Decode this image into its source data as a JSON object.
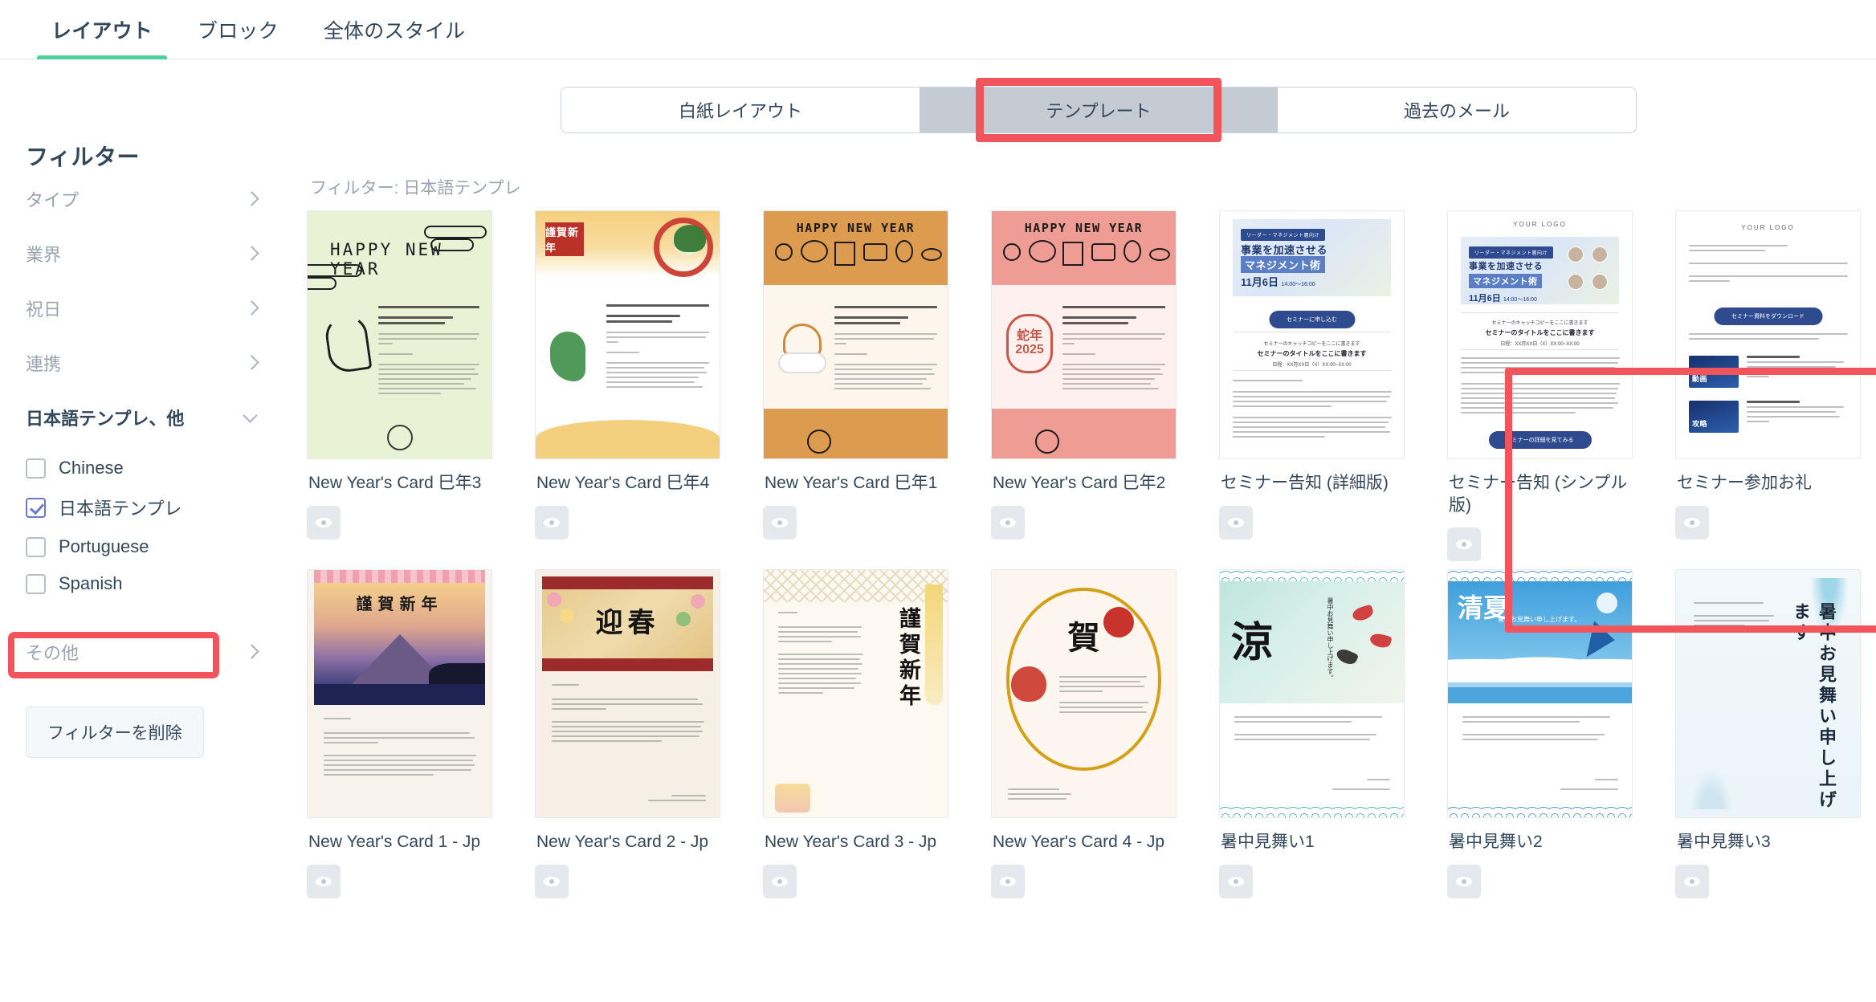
{
  "top_tabs": [
    {
      "label": "レイアウト",
      "active": true
    },
    {
      "label": "ブロック",
      "active": false
    },
    {
      "label": "全体のスタイル",
      "active": false
    }
  ],
  "segmented": {
    "options": [
      {
        "label": "白紙レイアウト",
        "selected": false
      },
      {
        "label": "テンプレート",
        "selected": true
      },
      {
        "label": "過去のメール",
        "selected": false
      }
    ]
  },
  "sidebar": {
    "title": "フィルター",
    "groups": [
      {
        "label": "タイプ",
        "expanded": false
      },
      {
        "label": "業界",
        "expanded": false
      },
      {
        "label": "祝日",
        "expanded": false
      },
      {
        "label": "連携",
        "expanded": false
      }
    ],
    "language_group": {
      "label": "日本語テンプレ、他",
      "expanded": true
    },
    "language_options": [
      {
        "label": "Chinese",
        "checked": false
      },
      {
        "label": "日本語テンプレ",
        "checked": true
      },
      {
        "label": "Portuguese",
        "checked": false
      },
      {
        "label": "Spanish",
        "checked": false
      }
    ],
    "other_group": {
      "label": "その他",
      "expanded": false
    },
    "clear_button": "フィルターを削除"
  },
  "main": {
    "filter_note": "フィルター: 日本語テンプレ",
    "preview_icon": "eye-icon"
  },
  "templates": [
    {
      "name": "New Year's Card 巳年3",
      "art": "ny3"
    },
    {
      "name": "New Year's Card 巳年4",
      "art": "ny4"
    },
    {
      "name": "New Year's Card 巳年1",
      "art": "ny1"
    },
    {
      "name": "New Year's Card 巳年2",
      "art": "ny2"
    },
    {
      "name": "セミナー告知 (詳細版)",
      "art": "sem1"
    },
    {
      "name": "セミナー告知 (シンプル版)",
      "art": "sem2"
    },
    {
      "name": "セミナー参加お礼",
      "art": "sem3"
    },
    {
      "name": "New Year's Card 1 - Jp",
      "art": "fuji"
    },
    {
      "name": "New Year's Card 2 - Jp",
      "art": "geishun"
    },
    {
      "name": "New Year's Card 3 - Jp",
      "art": "kinga"
    },
    {
      "name": "New Year's Card 4 - Jp",
      "art": "ga"
    },
    {
      "name": "暑中見舞い1",
      "art": "sum1"
    },
    {
      "name": "暑中見舞い2",
      "art": "sum2"
    },
    {
      "name": "暑中見舞い3",
      "art": "sum3"
    }
  ],
  "thumbnail_text": {
    "ny3": {
      "heading": "HAPPY NEW YEAR"
    },
    "ny4": {
      "stamp": "謹賀新年"
    },
    "ny1": {
      "heading": "HAPPY NEW YEAR"
    },
    "ny2": {
      "heading": "HAPPY NEW YEAR",
      "seal": "蛇年2025"
    },
    "sem1": {
      "tag": "リーダー・マネジメント層向け",
      "title1": "事業を加速させる",
      "title2": "マネジメント術",
      "date": "11月6日",
      "time": "14:00～16:00",
      "cta": "セミナーに申し込む",
      "catch": "セミナーのキャッチコピーをここに書きます",
      "subtitle": "セミナーのタイトルをここに書きます",
      "schedule": "日程：XX月XX日（X）XX:00~XX:00"
    },
    "sem2": {
      "logo": "YOUR LOGO",
      "tag": "リーダー・マネジメント層向け",
      "title1": "事業を加速させる",
      "title2": "マネジメント術",
      "date": "11月6日",
      "time": "14:00～16:00",
      "catch": "セミナーのキャッチコピーをここに書きます",
      "subtitle": "セミナーのタイトルをここに書きます",
      "schedule": "日程：XX月XX日（X）XX:00~XX:00",
      "cta": "セミナーの詳細を見てみる"
    },
    "sem3": {
      "logo": "YOUR LOGO",
      "cta": "セミナー資料をダウンロード"
    },
    "fuji": {
      "heading": "謹賀新年"
    },
    "geishun": {
      "heading": "迎春"
    },
    "kinga": {
      "heading": "謹賀新年"
    },
    "ga": {
      "heading": "賀"
    },
    "sum1": {
      "kanji": "涼",
      "message": "暑中お見舞い申し上げます。"
    },
    "sum2": {
      "kanji": "清夏",
      "message": "暑中お見舞い申し上げます。"
    },
    "sum3": {
      "kanji": "暑中お見舞い申し上げます"
    }
  },
  "annotations": {
    "accent_color": "#f2545b",
    "highlights": [
      "segmented-template-option",
      "japanese-template-checkbox",
      "seminar-template-group"
    ]
  }
}
